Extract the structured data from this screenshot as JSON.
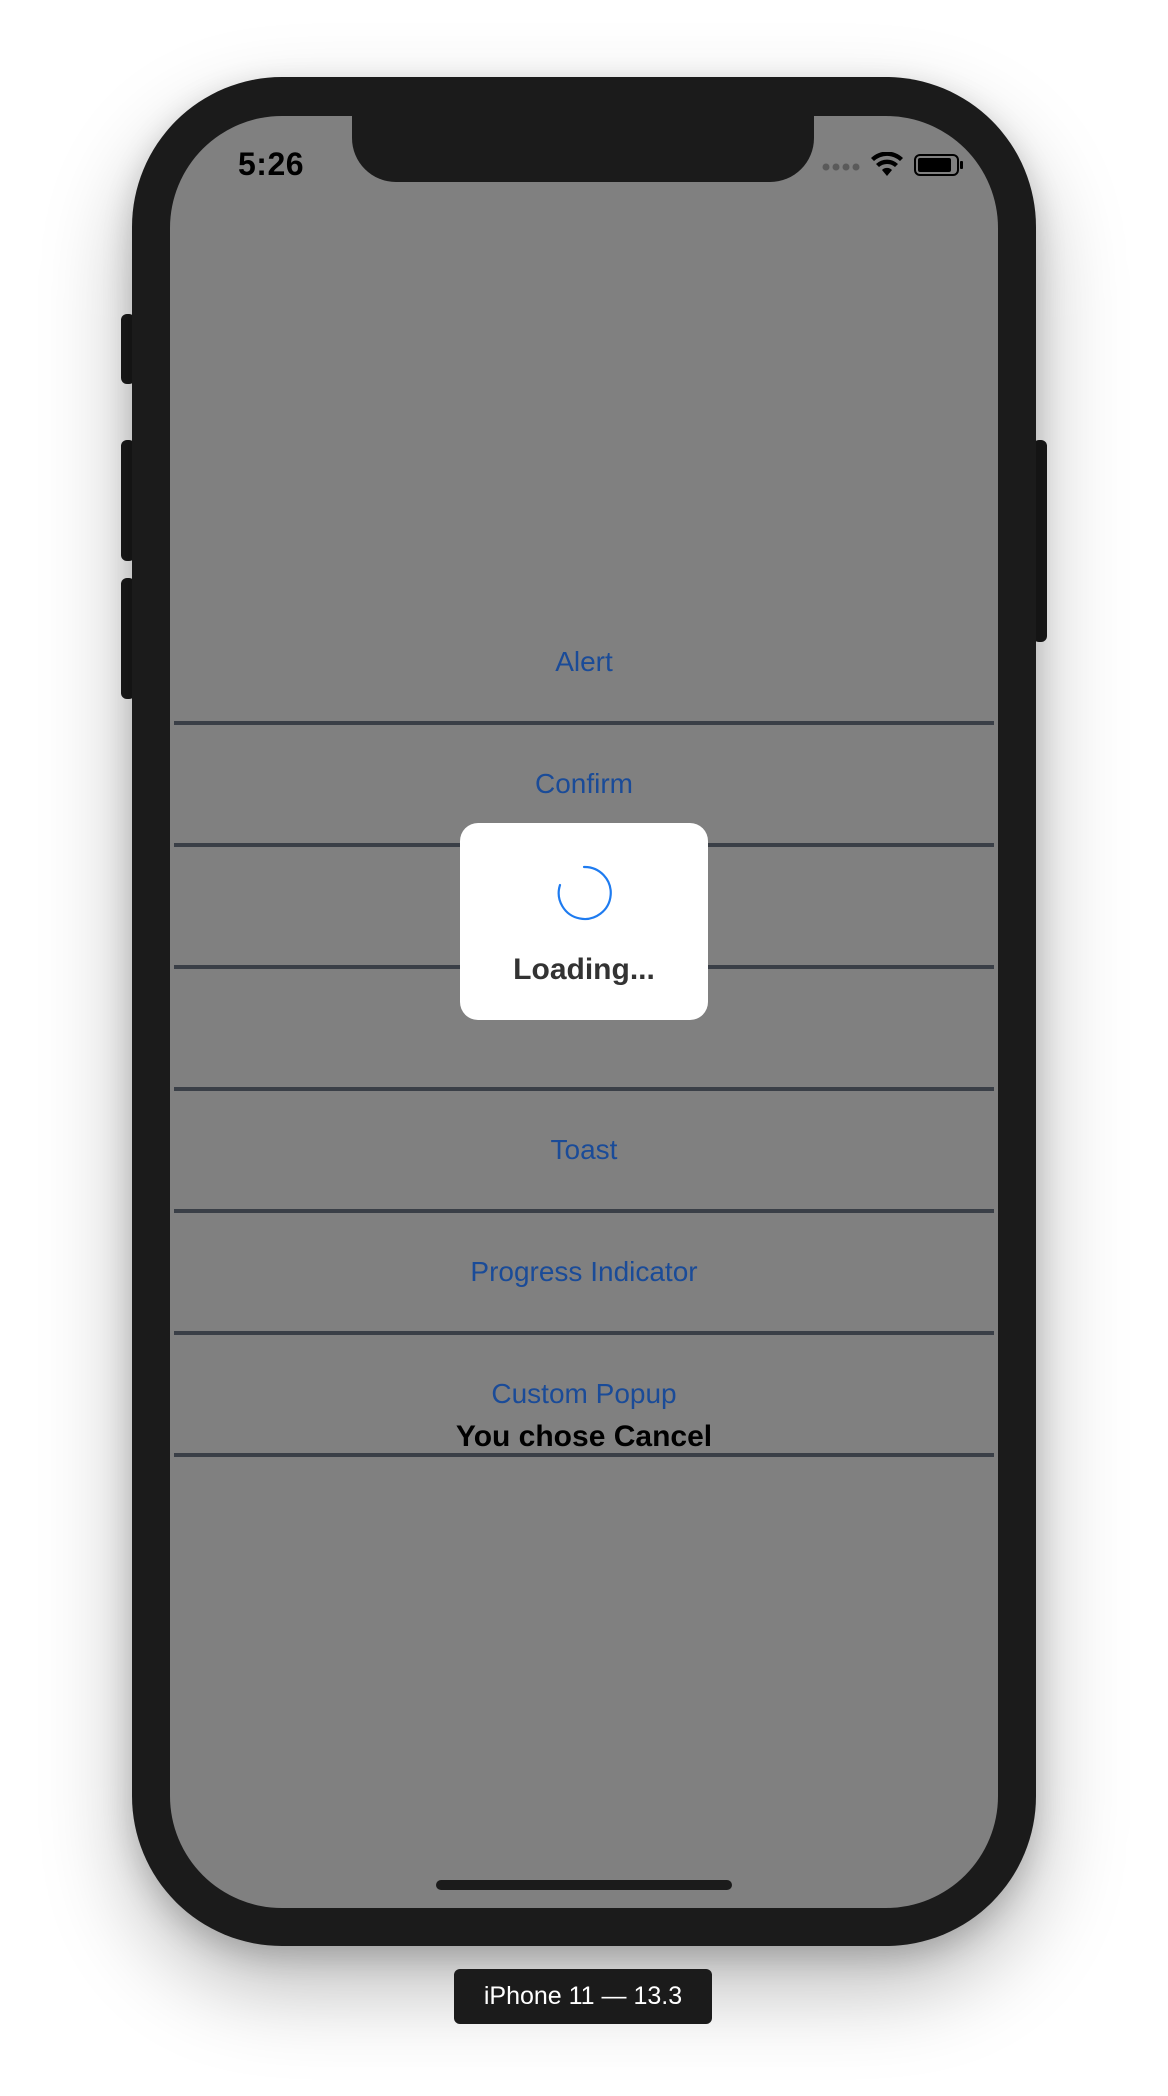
{
  "status_bar": {
    "time": "5:26",
    "icons": [
      "signal-dots-icon",
      "wifi-icon",
      "battery-icon"
    ]
  },
  "menu": {
    "items": [
      {
        "label": "Alert"
      },
      {
        "label": "Confirm"
      },
      {
        "label": ""
      },
      {
        "label": ""
      },
      {
        "label": "Toast"
      },
      {
        "label": "Progress Indicator"
      },
      {
        "label": "Custom Popup"
      }
    ]
  },
  "result_text": "You chose Cancel",
  "loading_dialog": {
    "text": "Loading..."
  },
  "device_label": "iPhone 11 — 13.3",
  "colors": {
    "overlay": "#808080",
    "link": "#1a4b98",
    "divider": "#3a3f47",
    "spinner": "#1e7bf0"
  }
}
